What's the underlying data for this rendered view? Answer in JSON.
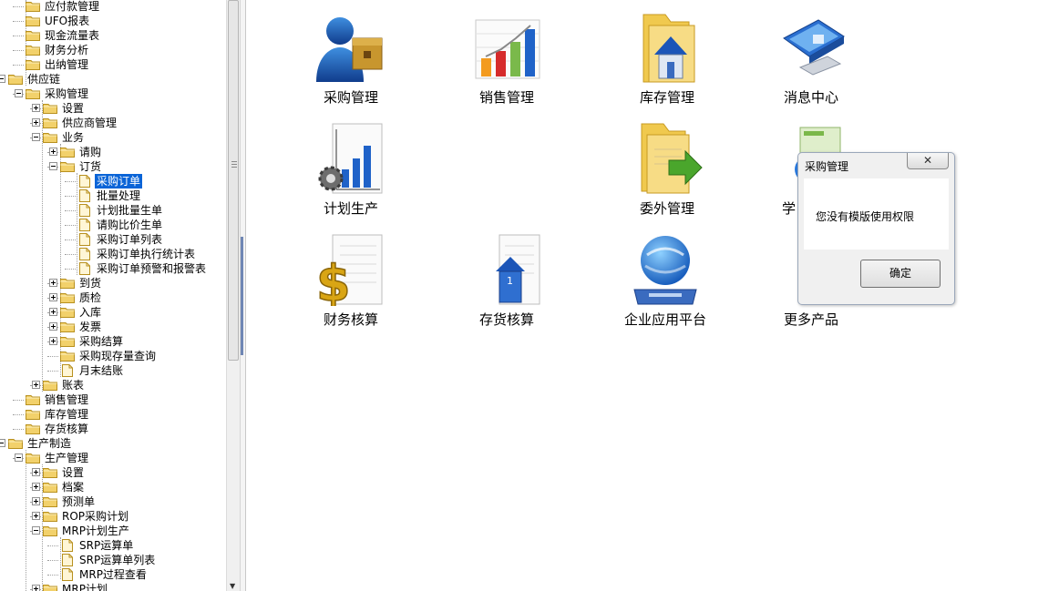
{
  "tree": {
    "nodes": [
      "应付款管理",
      "UFO报表",
      "现金流量表",
      "财务分析",
      "出纳管理",
      "供应链",
      "采购管理",
      "设置",
      "供应商管理",
      "业务",
      "请购",
      "订货",
      "采购订单",
      "批量处理",
      "计划批量生单",
      "请购比价生单",
      "采购订单列表",
      "采购订单执行统计表",
      "采购订单预警和报警表",
      "到货",
      "质检",
      "入库",
      "发票",
      "采购结算",
      "采购现存量查询",
      "月末结账",
      "账表",
      "销售管理",
      "库存管理",
      "存货核算",
      "生产制造",
      "生产管理",
      "设置",
      "档案",
      "预测单",
      "ROP采购计划",
      "MRP计划生产",
      "SRP运算单",
      "SRP运算单列表",
      "MRP过程查看",
      "MRP计划"
    ],
    "selected_index": 12
  },
  "apps": [
    {
      "label": "采购管理",
      "icon": "purchase-icon"
    },
    {
      "label": "销售管理",
      "icon": "sales-chart-icon"
    },
    {
      "label": "库存管理",
      "icon": "inventory-folder-icon"
    },
    {
      "label": "消息中心",
      "icon": "monitor-icon"
    },
    {
      "label": "计划生产",
      "icon": "planning-chart-icon"
    },
    {
      "label": "委外管理",
      "icon": "outsource-folder-icon"
    },
    {
      "label": "学",
      "icon": "learning-icon"
    },
    {
      "label": "财务核算",
      "icon": "finance-dollar-icon"
    },
    {
      "label": "存货核算",
      "icon": "stock-accounting-icon"
    },
    {
      "label": "企业应用平台",
      "icon": "globe-platform-icon"
    },
    {
      "label": "更多产品",
      "icon": "more-products-icon"
    }
  ],
  "dialog": {
    "title": "采购管理",
    "close_glyph": "✕",
    "message": "您没有模版使用权限",
    "ok_label": "确定"
  },
  "colors": {
    "selection": "#0a64d7",
    "folder": "#f2d16b",
    "dialog_bg": "#f0f0f0"
  }
}
